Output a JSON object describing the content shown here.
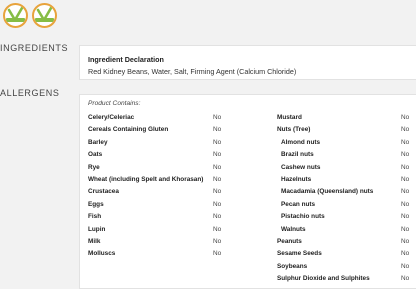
{
  "badges": [
    {
      "name": "vegetarian-badge",
      "color": "#86bd45",
      "ring": "#e8a33c"
    },
    {
      "name": "vegan-badge",
      "color": "#86bd45",
      "ring": "#e8a33c"
    }
  ],
  "ingredients": {
    "section_label": "INGREDIENTS",
    "declaration_title": "Ingredient Declaration",
    "declaration_text": "Red Kidney Beans, Water, Salt, Firming Agent (Calcium Chloride)"
  },
  "allergens": {
    "section_label": "ALLERGENS",
    "contains_label": "Product Contains:",
    "left": [
      {
        "name": "Celery/Celeriac",
        "value": "No"
      },
      {
        "name": "Cereals Containing Gluten",
        "value": "No"
      },
      {
        "name": "Barley",
        "value": "No"
      },
      {
        "name": "Oats",
        "value": "No"
      },
      {
        "name": "Rye",
        "value": "No"
      },
      {
        "name": "Wheat (including Spelt and Khorasan)",
        "value": "No"
      },
      {
        "name": "Crustacea",
        "value": "No"
      },
      {
        "name": "Eggs",
        "value": "No"
      },
      {
        "name": "Fish",
        "value": "No"
      },
      {
        "name": "Lupin",
        "value": "No"
      },
      {
        "name": "Milk",
        "value": "No"
      },
      {
        "name": "Molluscs",
        "value": "No"
      }
    ],
    "right": [
      {
        "name": "Mustard",
        "value": "No"
      },
      {
        "name": "Nuts (Tree)",
        "value": "No"
      },
      {
        "name": "Almond nuts",
        "value": "No"
      },
      {
        "name": "Brazil nuts",
        "value": "No"
      },
      {
        "name": "Cashew nuts",
        "value": "No"
      },
      {
        "name": "Hazelnuts",
        "value": "No"
      },
      {
        "name": "Macadamia (Queensland) nuts",
        "value": "No"
      },
      {
        "name": "Pecan nuts",
        "value": "No"
      },
      {
        "name": "Pistachio nuts",
        "value": "No"
      },
      {
        "name": "Walnuts",
        "value": "No"
      },
      {
        "name": "Peanuts",
        "value": "No"
      },
      {
        "name": "Sesame Seeds",
        "value": "No"
      },
      {
        "name": "Soybeans",
        "value": "No"
      },
      {
        "name": "Sulphur Dioxide and Sulphites",
        "value": "No"
      }
    ]
  }
}
